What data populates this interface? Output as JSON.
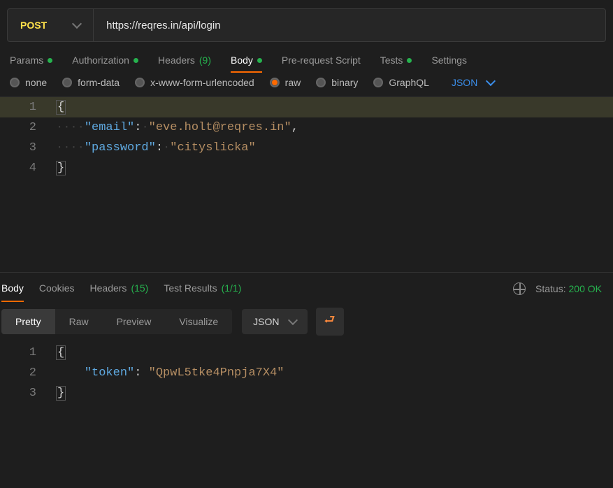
{
  "request": {
    "method": "POST",
    "url": "https://reqres.in/api/login"
  },
  "req_tabs": {
    "params": "Params",
    "authorization": "Authorization",
    "headers_label": "Headers",
    "headers_count": "(9)",
    "body": "Body",
    "prerequest": "Pre-request Script",
    "tests": "Tests",
    "settings": "Settings"
  },
  "body_types": {
    "none": "none",
    "formdata": "form-data",
    "urlencoded": "x-www-form-urlencoded",
    "raw": "raw",
    "binary": "binary",
    "graphql": "GraphQL",
    "json_dd": "JSON"
  },
  "req_body": {
    "indent_dots": "····",
    "l1": "{",
    "k1": "\"email\"",
    "v1": "\"eve.holt@reqres.in\"",
    "comma": ",",
    "k2": "\"password\"",
    "v2": "\"cityslicka\"",
    "l4": "}",
    "ln1": "1",
    "ln2": "2",
    "ln3": "3",
    "ln4": "4"
  },
  "resp_tabs": {
    "body": "Body",
    "cookies": "Cookies",
    "headers_label": "Headers",
    "headers_count": "(15)",
    "testresults_label": "Test Results",
    "testresults_count": "(1/1)"
  },
  "status": {
    "label": "Status:",
    "value": "200 OK"
  },
  "resp_views": {
    "pretty": "Pretty",
    "raw": "Raw",
    "preview": "Preview",
    "visualize": "Visualize",
    "json_dd": "JSON"
  },
  "resp_body": {
    "l1": "{",
    "indent": "    ",
    "k1": "\"token\"",
    "v1": "\"QpwL5tke4Pnpja7X4\"",
    "l3": "}",
    "ln1": "1",
    "ln2": "2",
    "ln3": "3"
  }
}
